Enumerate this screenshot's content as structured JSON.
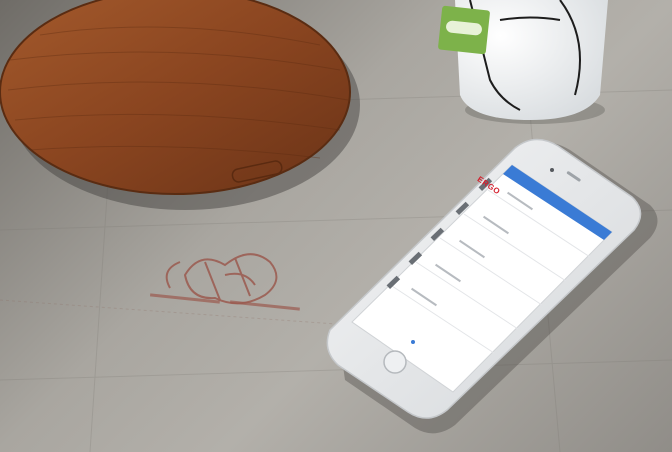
{
  "scene": {
    "description_free": true,
    "objects": {
      "cutting_board_engraving": "",
      "mug_tag_label": "",
      "linen_monogram_text": ""
    }
  },
  "phone_screen": {
    "header_title": "",
    "rows": [
      {
        "logo": "ERGO",
        "title": "",
        "amount": ""
      },
      {
        "logo": "",
        "title": "",
        "amount": ""
      },
      {
        "logo": "",
        "title": "",
        "amount": ""
      },
      {
        "logo": "",
        "title": "",
        "amount": ""
      },
      {
        "logo": "",
        "title": "",
        "amount": ""
      }
    ]
  },
  "colors": {
    "app_header": "#3a7bd5",
    "board_wood": "#8a4a22",
    "linen": "#a9a6a0",
    "monogram": "#9b5a4f",
    "tag_green": "#7db24a"
  }
}
